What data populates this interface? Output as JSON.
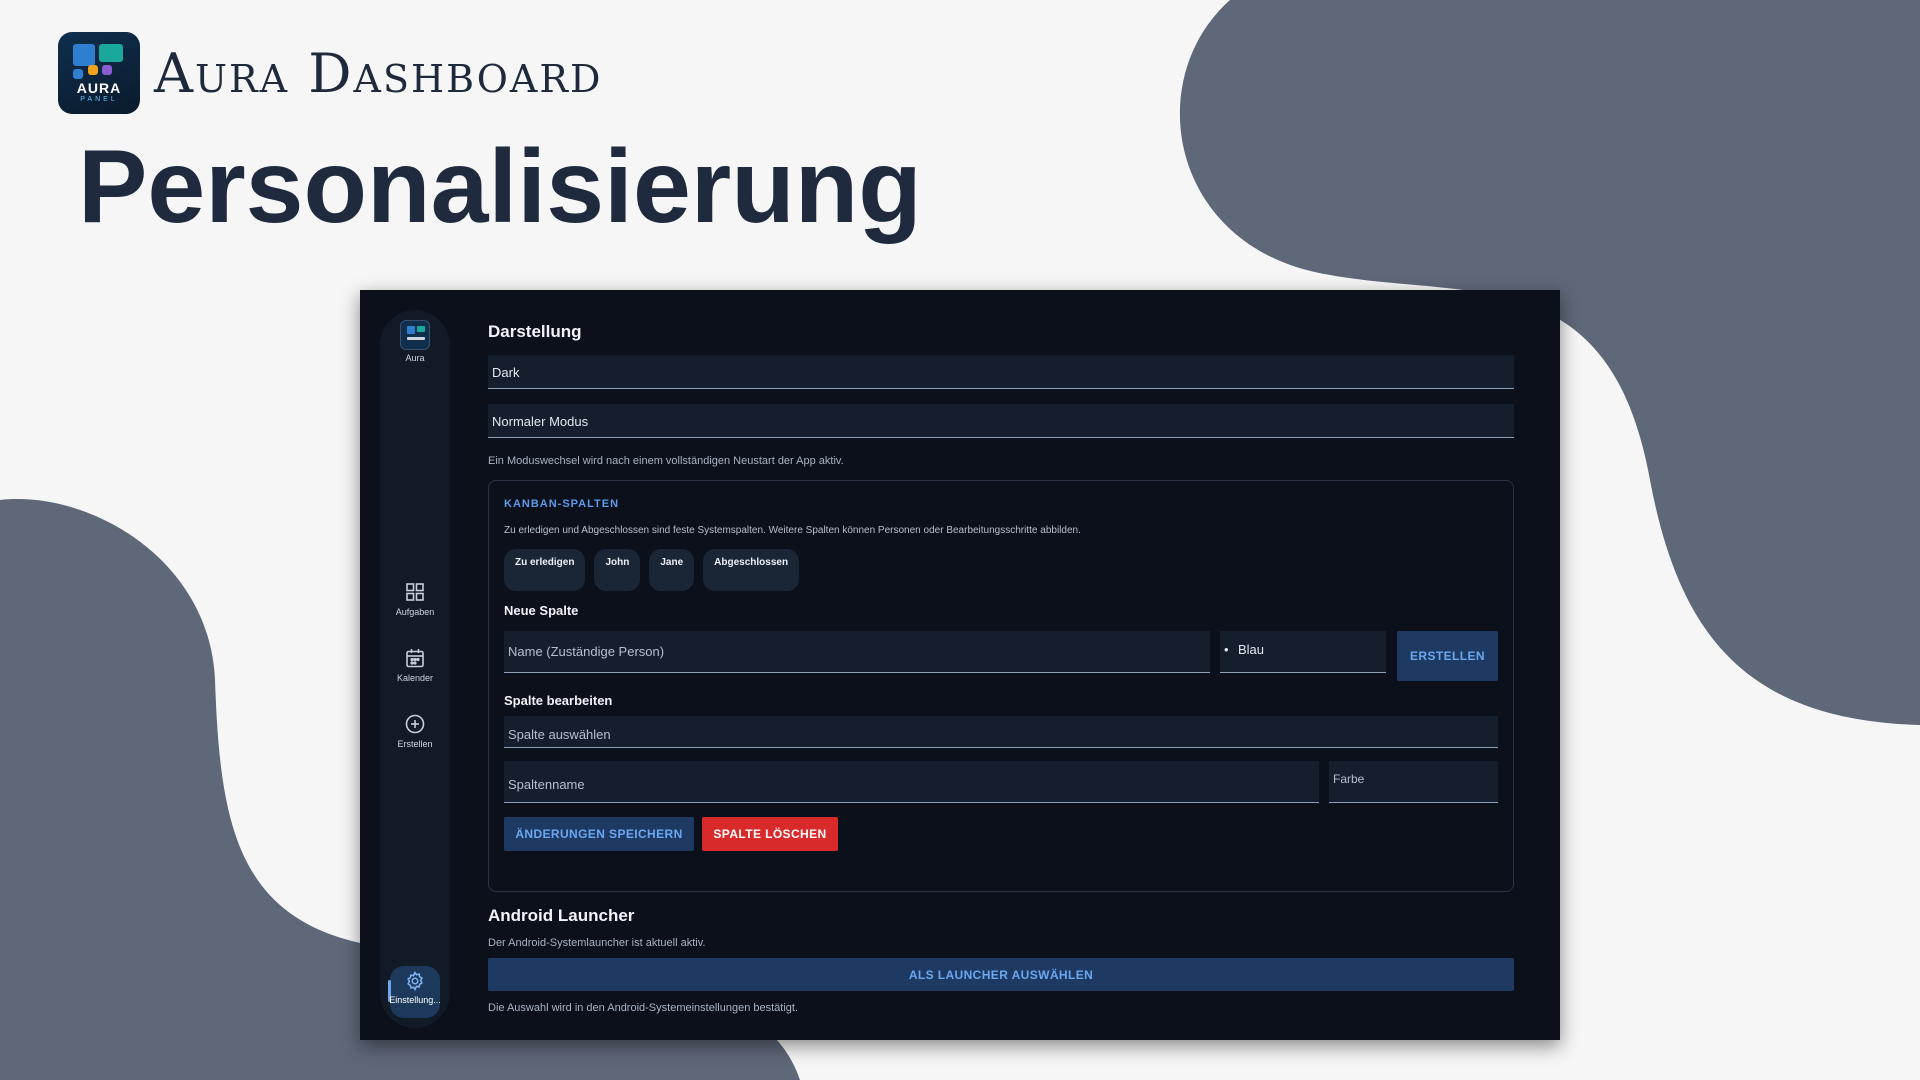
{
  "brand": {
    "name": "Aura Dashboard",
    "logo_word": "AURA",
    "logo_sub": "PANEL"
  },
  "page_title": "Personalisierung",
  "colors": {
    "background": "#f6f6f6",
    "blob": "#5f6879",
    "window": "#0b101b",
    "accent": "#5d9bec",
    "danger": "#d82a2a"
  },
  "sidebar": {
    "logo_label": "Aura",
    "items": [
      {
        "label": "Aufgaben",
        "icon": "grid-icon"
      },
      {
        "label": "Kalender",
        "icon": "calendar-icon"
      },
      {
        "label": "Erstellen",
        "icon": "plus-circle-icon"
      },
      {
        "label": "Einstellung...",
        "icon": "gear-icon",
        "active": true
      }
    ]
  },
  "appearance": {
    "title": "Darstellung",
    "theme_value": "Dark",
    "mode_value": "Normaler Modus",
    "hint": "Ein Moduswechsel wird nach einem vollständigen Neustart der App aktiv."
  },
  "kanban": {
    "title": "KANBAN-SPALTEN",
    "description": "Zu erledigen und Abgeschlossen sind feste Systemspalten. Weitere Spalten können Personen oder Bearbeitungsschritte abbilden.",
    "columns": [
      "Zu erledigen",
      "John",
      "Jane",
      "Abgeschlossen"
    ],
    "new_column": {
      "title": "Neue Spalte",
      "name_placeholder": "Name (Zuständige Person)",
      "color_value": "Blau",
      "create_label": "ERSTELLEN"
    },
    "edit_column": {
      "title": "Spalte bearbeiten",
      "select_placeholder": "Spalte auswählen",
      "name_placeholder": "Spaltenname",
      "color_placeholder": "Farbe",
      "save_label": "ÄNDERUNGEN SPEICHERN",
      "delete_label": "SPALTE LÖSCHEN"
    }
  },
  "launcher": {
    "title": "Android Launcher",
    "status": "Der Android-Systemlauncher ist aktuell aktiv.",
    "button_label": "ALS LAUNCHER AUSWÄHLEN",
    "footnote": "Die Auswahl wird in den Android-Systemeinstellungen bestätigt."
  }
}
